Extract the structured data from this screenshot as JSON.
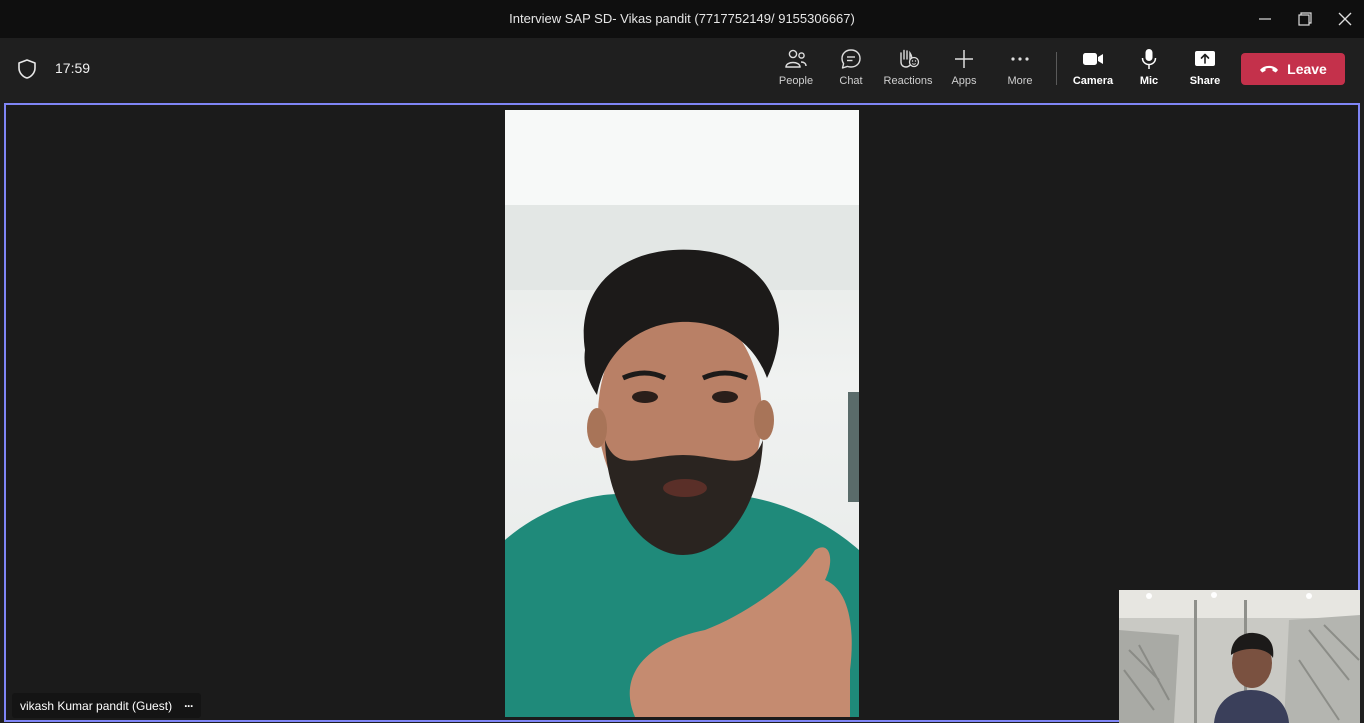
{
  "window": {
    "title": "Interview SAP SD- Vikas pandit (7717752149/ 9155306667)"
  },
  "header": {
    "timer": "17:59",
    "tools": [
      {
        "label": "People",
        "icon": "people-icon"
      },
      {
        "label": "Chat",
        "icon": "chat-icon"
      },
      {
        "label": "Reactions",
        "icon": "reactions-icon"
      },
      {
        "label": "Apps",
        "icon": "plus-icon"
      },
      {
        "label": "More",
        "icon": "more-icon"
      },
      {
        "label": "Camera",
        "icon": "camera-icon"
      },
      {
        "label": "Mic",
        "icon": "mic-icon"
      },
      {
        "label": "Share",
        "icon": "share-icon"
      }
    ],
    "leave_label": "Leave"
  },
  "stage": {
    "participant_name": "vikash Kumar pandit (Guest)",
    "more_glyph": "···"
  },
  "colors": {
    "leave": "#c4314b",
    "active_border": "#7f85f5"
  }
}
